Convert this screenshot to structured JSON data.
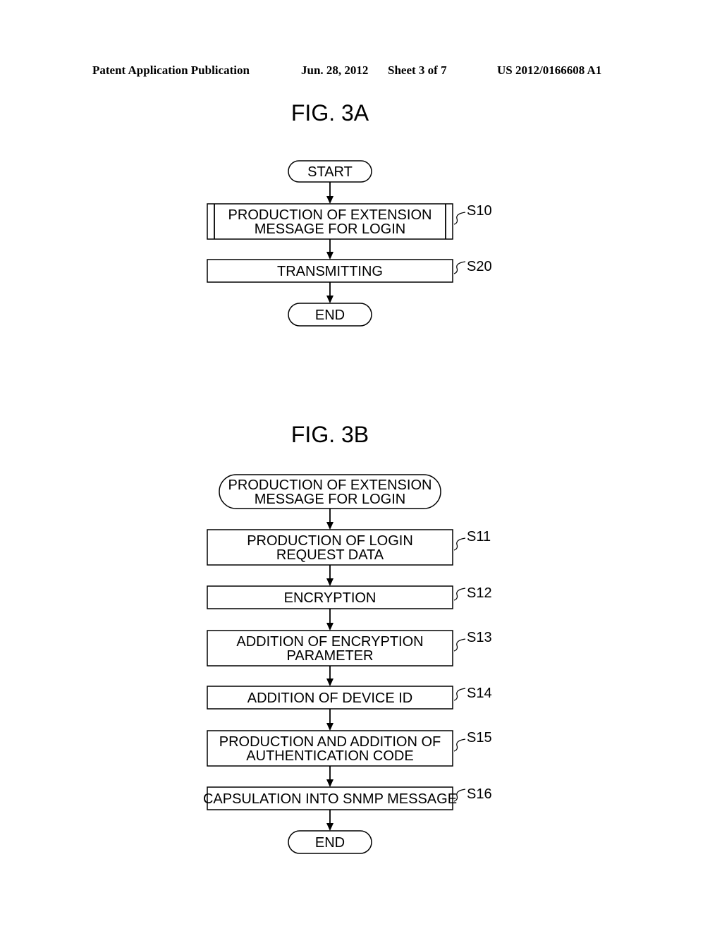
{
  "header": {
    "publication": "Patent Application Publication",
    "date": "Jun. 28, 2012",
    "sheet": "Sheet 3 of 7",
    "number": "US 2012/0166608 A1"
  },
  "figures": [
    {
      "title": "FIG. 3A",
      "nodes": [
        {
          "kind": "terminal",
          "lines": [
            "START"
          ],
          "step": ""
        },
        {
          "kind": "subprocess",
          "lines": [
            "PRODUCTION OF EXTENSION",
            "MESSAGE FOR LOGIN"
          ],
          "step": "S10"
        },
        {
          "kind": "process",
          "lines": [
            "TRANSMITTING"
          ],
          "step": "S20"
        },
        {
          "kind": "terminal",
          "lines": [
            "END"
          ],
          "step": ""
        }
      ]
    },
    {
      "title": "FIG. 3B",
      "nodes": [
        {
          "kind": "terminal",
          "lines": [
            "PRODUCTION OF EXTENSION",
            "MESSAGE FOR LOGIN"
          ],
          "step": ""
        },
        {
          "kind": "process",
          "lines": [
            "PRODUCTION OF LOGIN",
            "REQUEST DATA"
          ],
          "step": "S11"
        },
        {
          "kind": "process",
          "lines": [
            "ENCRYPTION"
          ],
          "step": "S12"
        },
        {
          "kind": "process",
          "lines": [
            "ADDITION OF ENCRYPTION",
            "PARAMETER"
          ],
          "step": "S13"
        },
        {
          "kind": "process",
          "lines": [
            "ADDITION OF DEVICE ID"
          ],
          "step": "S14"
        },
        {
          "kind": "process",
          "lines": [
            "PRODUCTION AND ADDITION OF",
            "AUTHENTICATION CODE"
          ],
          "step": "S15"
        },
        {
          "kind": "process",
          "lines": [
            "CAPSULATION INTO SNMP MESSAGE"
          ],
          "step": "S16"
        },
        {
          "kind": "terminal",
          "lines": [
            "END"
          ],
          "step": ""
        }
      ]
    }
  ]
}
